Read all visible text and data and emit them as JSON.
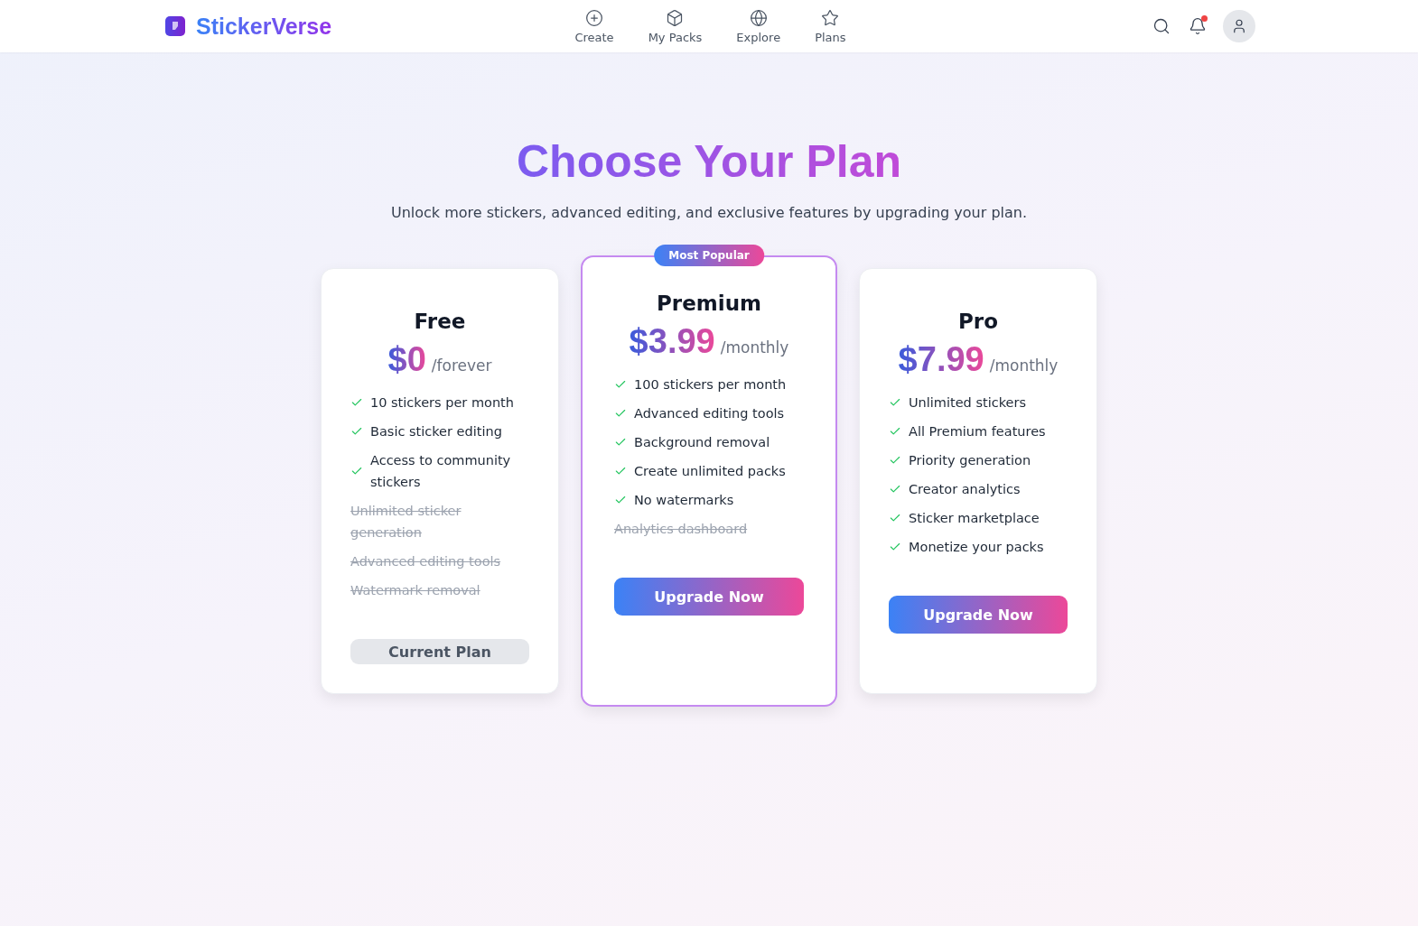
{
  "header": {
    "brand": "StickerVerse",
    "nav": [
      {
        "label": "Create"
      },
      {
        "label": "My Packs"
      },
      {
        "label": "Explore"
      },
      {
        "label": "Plans"
      }
    ],
    "has_notification": true
  },
  "title": "Choose Your Plan",
  "subtitle": "Unlock more stickers, advanced editing, and exclusive features by upgrading your plan.",
  "plans": [
    {
      "name": "Free",
      "price": "$0",
      "period": "/forever",
      "featured": false,
      "features": [
        {
          "text": "10 stickers per month",
          "included": true
        },
        {
          "text": "Basic sticker editing",
          "included": true
        },
        {
          "text": "Access to community stickers",
          "included": true
        },
        {
          "text": "Unlimited sticker generation",
          "included": false
        },
        {
          "text": "Advanced editing tools",
          "included": false
        },
        {
          "text": "Watermark removal",
          "included": false
        }
      ],
      "button": {
        "label": "Current Plan",
        "kind": "current"
      }
    },
    {
      "name": "Premium",
      "badge": "Most Popular",
      "price": "$3.99",
      "period": "/monthly",
      "featured": true,
      "features": [
        {
          "text": "100 stickers per month",
          "included": true
        },
        {
          "text": "Advanced editing tools",
          "included": true
        },
        {
          "text": "Background removal",
          "included": true
        },
        {
          "text": "Create unlimited packs",
          "included": true
        },
        {
          "text": "No watermarks",
          "included": true
        },
        {
          "text": "Analytics dashboard",
          "included": false
        }
      ],
      "button": {
        "label": "Upgrade Now",
        "kind": "upgrade"
      }
    },
    {
      "name": "Pro",
      "price": "$7.99",
      "period": "/monthly",
      "featured": false,
      "features": [
        {
          "text": "Unlimited stickers",
          "included": true
        },
        {
          "text": "All Premium features",
          "included": true
        },
        {
          "text": "Priority generation",
          "included": true
        },
        {
          "text": "Creator analytics",
          "included": true
        },
        {
          "text": "Sticker marketplace",
          "included": true
        },
        {
          "text": "Monetize your packs",
          "included": true
        }
      ],
      "button": {
        "label": "Upgrade Now",
        "kind": "upgrade"
      }
    }
  ]
}
